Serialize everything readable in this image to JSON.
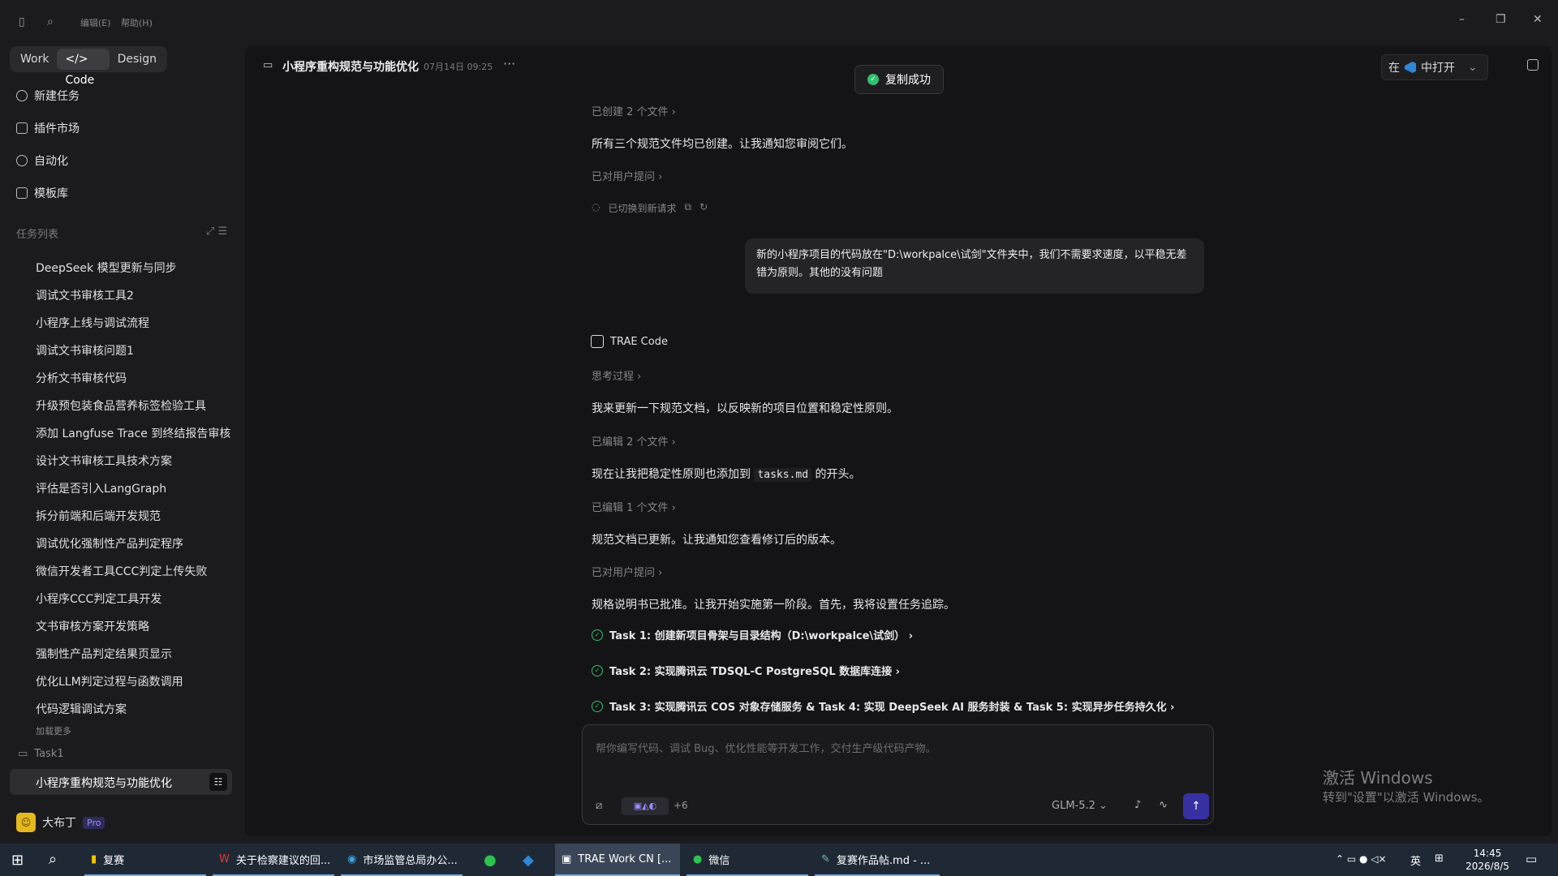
{
  "titlebar": {
    "menu_edit": "编辑(E)",
    "menu_help": "帮助(H)"
  },
  "sidebar": {
    "tabs": [
      {
        "label": "Work"
      },
      {
        "label": "</> Code"
      },
      {
        "label": "Design"
      }
    ],
    "nav": [
      {
        "label": "新建任务"
      },
      {
        "label": "插件市场"
      },
      {
        "label": "自动化"
      },
      {
        "label": "模板库"
      }
    ],
    "task_list_title": "任务列表",
    "tasks": [
      "DeepSeek 模型更新与同步",
      "调试文书审核工具2",
      "小程序上线与调试流程",
      "调试文书审核问题1",
      "分析文书审核代码",
      "升级预包装食品营养标签检验工具",
      "添加 Langfuse Trace 到终结报告审核",
      "设计文书审核工具技术方案",
      "评估是否引入LangGraph",
      "拆分前端和后端开发规范",
      "调试优化强制性产品判定程序",
      "微信开发者工具CCC判定上传失败",
      "小程序CCC判定工具开发",
      "文书审核方案开发策略",
      "强制性产品判定结果页显示",
      "优化LLM判定过程与函数调用",
      "代码逻辑调试方案"
    ],
    "load_more": "加载更多",
    "folder": "Task1",
    "active_task": "小程序重构规范与功能优化",
    "user_name": "大布丁",
    "user_badge": "Pro"
  },
  "panel": {
    "title": "小程序重构规范与功能优化",
    "time": "07月14日 09:25",
    "toast": "复制成功",
    "open_prefix": "在",
    "open_suffix": "中打开"
  },
  "chat": {
    "created_files": "已创建 2 个文件 ›",
    "msg1": "所有三个规范文件均已创建。让我通知您审阅它们。",
    "asked_user": "已对用户提问 ›",
    "switched": "已切换到新请求",
    "user_msg": "新的小程序项目的代码放在\"D:\\workpalce\\试剑\"文件夹中，我们不需要求速度，以平稳无差错为原则。其他的没有问题",
    "agent_name": "TRAE Code",
    "thinking": "思考过程 ›",
    "msg2": "我来更新一下规范文档，以反映新的项目位置和稳定性原则。",
    "edited2": "已编辑 2 个文件 ›",
    "msg3_a": "现在让我把稳定性原则也添加到",
    "msg3_code": "tasks.md",
    "msg3_b": "的开头。",
    "edited1": "已编辑 1 个文件 ›",
    "msg4": "规范文档已更新。让我通知您查看修订后的版本。",
    "asked_user2": "已对用户提问 ›",
    "msg5": "规格说明书已批准。让我开始实施第一阶段。首先，我将设置任务追踪。",
    "task1": "Task 1: 创建新项目骨架与目录结构（D:\\workpalce\\试剑） ›",
    "task2": "Task 2: 实现腾讯云 TDSQL-C PostgreSQL 数据库连接 ›",
    "task3": "Task 3: 实现腾讯云 COS 对象存储服务 & Task 4: 实现 DeepSeek AI 服务封装 & Task 5: 实现异步任务持久化 ›"
  },
  "input": {
    "placeholder": "帮你编写代码、调试 Bug、优化性能等开发工作，交付生产级代码产物。",
    "plus_count": "+6",
    "model": "GLM-5.2 ⌄"
  },
  "watermark": {
    "line1": "激活 Windows",
    "line2": "转到\"设置\"以激活 Windows。"
  },
  "taskbar": {
    "apps": [
      "复赛",
      "关于检察建议的回...",
      "市场监管总局办公...",
      "",
      "",
      "TRAE Work CN [...",
      "微信",
      "复赛作品帖.md - ..."
    ],
    "ime": "英",
    "time": "14:45",
    "date": "2026/8/5"
  },
  "colors": {
    "accent": "#3730a3",
    "success": "#2fbf71"
  }
}
